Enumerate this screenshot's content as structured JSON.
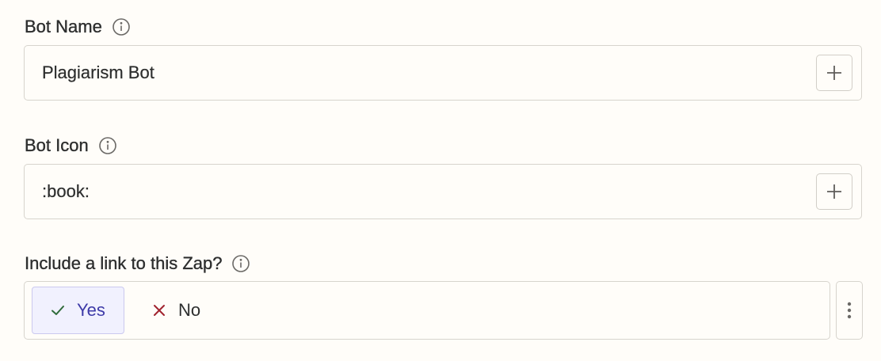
{
  "fields": {
    "bot_name": {
      "label": "Bot Name",
      "value": "Plagiarism Bot",
      "info_icon": "info-icon",
      "insert_icon": "plus-icon"
    },
    "bot_icon": {
      "label": "Bot Icon",
      "value": ":book:",
      "info_icon": "info-icon",
      "insert_icon": "plus-icon"
    },
    "include_link": {
      "label": "Include a link to this Zap?",
      "info_icon": "info-icon",
      "options": [
        {
          "label": "Yes",
          "icon": "check-icon",
          "selected": true
        },
        {
          "label": "No",
          "icon": "x-icon",
          "selected": false
        }
      ],
      "menu_icon": "kebab-menu-icon"
    }
  },
  "colors": {
    "background": "#fffdf9",
    "border": "#d7d4cd",
    "selected_bg": "#f1f1fe",
    "selected_border": "#cbc9ef",
    "selected_text": "#3d3aa8",
    "check_green": "#2f6b3a",
    "x_red": "#a1232f"
  }
}
